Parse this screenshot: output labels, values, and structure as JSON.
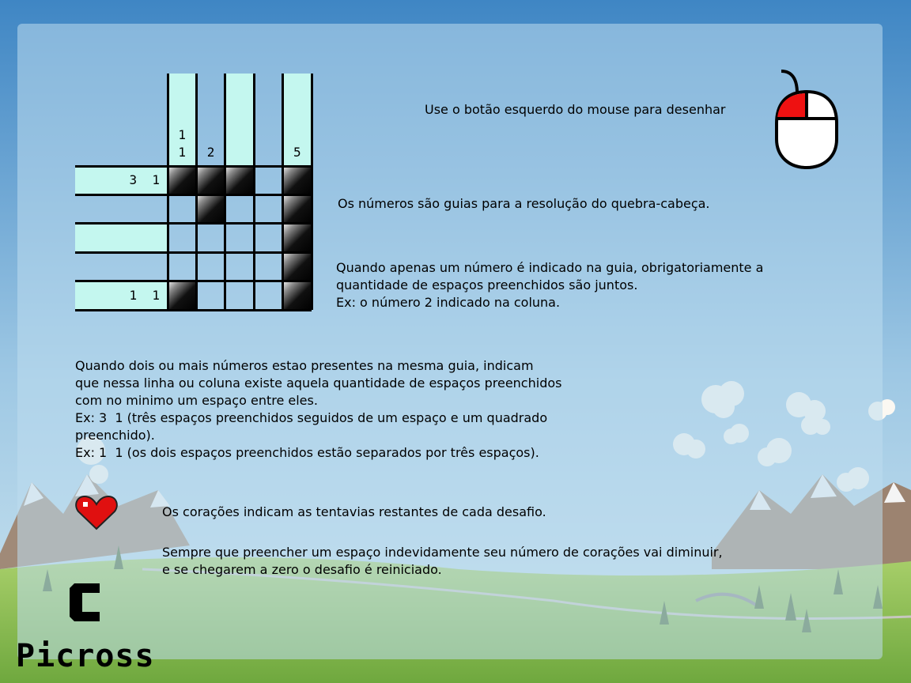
{
  "instructions": {
    "mouse": "Use o botão esquerdo do mouse para desenhar",
    "numbers": "Os números são guias para a resolução do quebra-cabeça.",
    "single_number": "Quando apenas um número é indicado na guia, obrigatoriamente a\nquantidade de espaços preenchidos são juntos.\nEx: o número 2 indicado na coluna.",
    "multi_number": "Quando dois ou mais números estao presentes na mesma guia, indicam\nque nessa linha ou coluna existe aquela quantidade de espaços preenchidos\ncom no minimo um espaço entre eles.\nEx: 3  1 (três espaços preenchidos seguidos de um espaço e um quadrado\npreenchido).\nEx: 1  1 (os dois espaços preenchidos estão separados por três espaços).",
    "hearts": "Os corações indicam as tentavias restantes de cada desafio.",
    "penalty": "Sempre que preencher um espaço indevidamente seu número de corações vai diminuir,\ne se chegarem a zero o desafio é reiniciado."
  },
  "puzzle": {
    "column_clues": [
      [
        "1",
        "1"
      ],
      [
        "2"
      ],
      [],
      [],
      [
        "5"
      ]
    ],
    "row_clues": [
      "3  1",
      "",
      "",
      "",
      "1  1"
    ],
    "column_highlight": [
      true,
      false,
      true,
      false,
      true
    ],
    "row_highlight": [
      true,
      false,
      true,
      false,
      true
    ],
    "grid": [
      [
        1,
        1,
        1,
        0,
        1
      ],
      [
        0,
        1,
        0,
        0,
        1
      ],
      [
        0,
        0,
        0,
        0,
        1
      ],
      [
        0,
        0,
        0,
        0,
        1
      ],
      [
        1,
        0,
        0,
        0,
        1
      ]
    ]
  },
  "logo": {
    "letter": "C",
    "name": "Picross"
  },
  "icons": {
    "mouse": "mouse-left-click-icon",
    "heart": "heart-icon"
  },
  "colors": {
    "guide": "#c4f7ef",
    "mouse_button": "#ee1111",
    "heart": "#e01010"
  }
}
